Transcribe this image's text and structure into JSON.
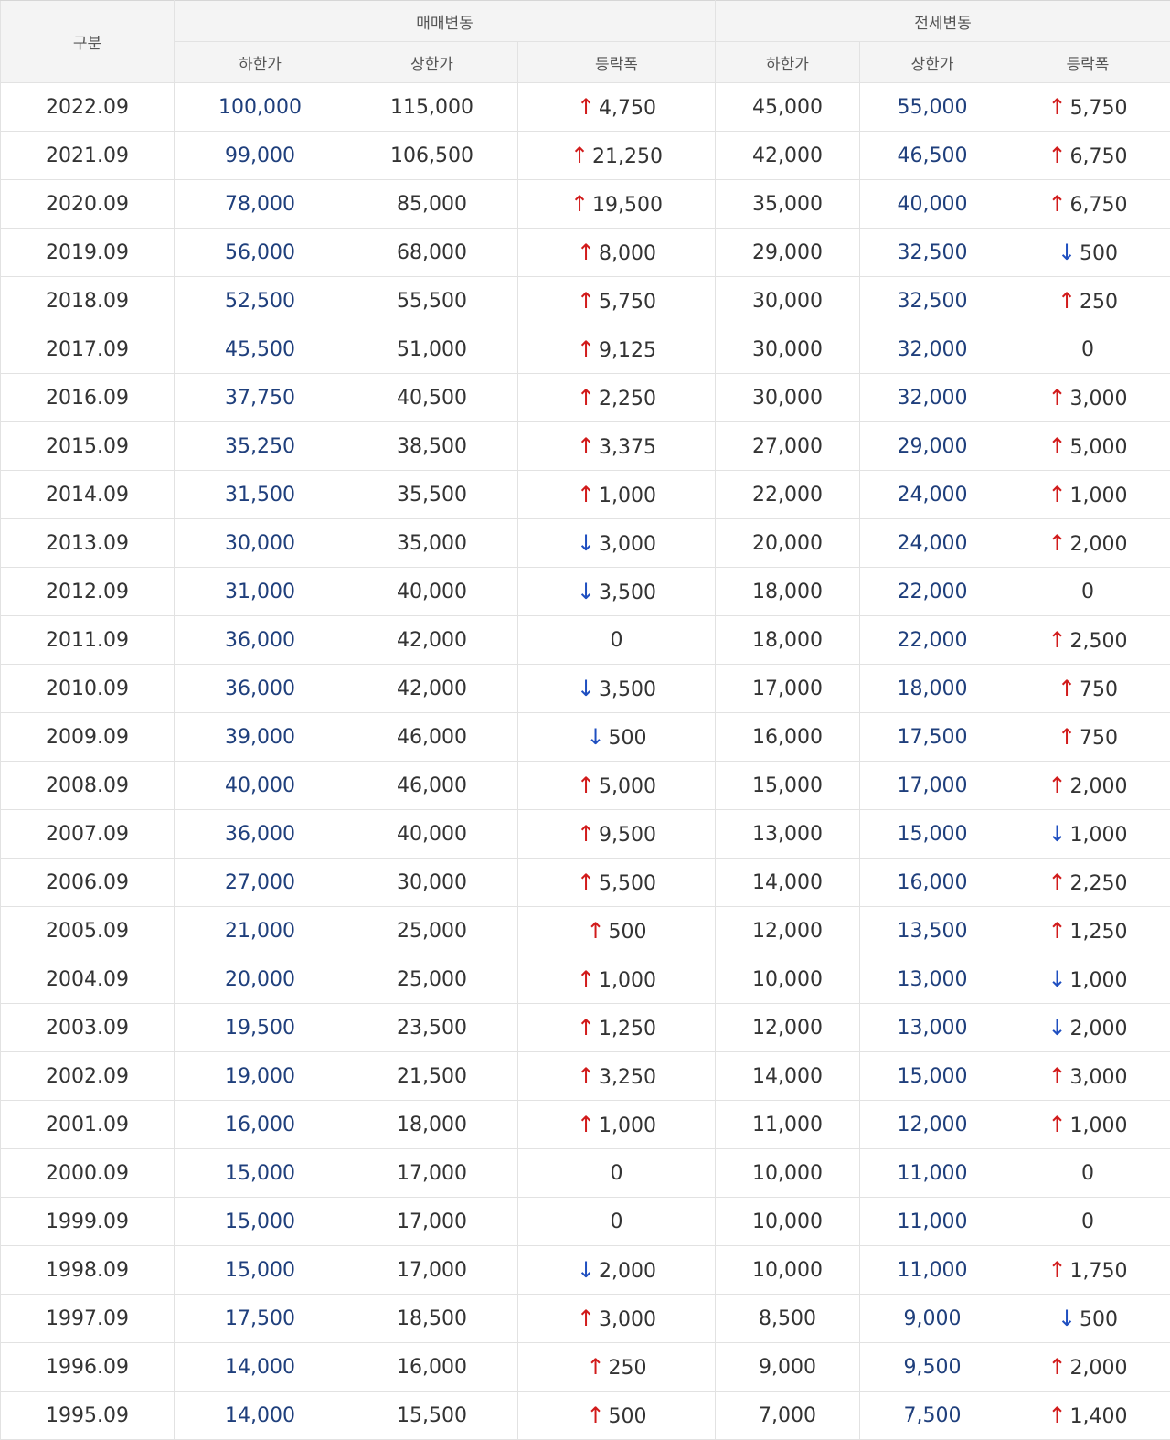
{
  "header": {
    "category_label": "구분",
    "sale_group_label": "매매변동",
    "jeonse_group_label": "전세변동",
    "low_label": "하한가",
    "high_label": "상한가",
    "change_label": "등락폭"
  },
  "rows": [
    {
      "period": "2022.09",
      "sale_low": "100,000",
      "sale_high": "115,000",
      "sale_dir": "up",
      "sale_change": "4,750",
      "jeonse_low": "45,000",
      "jeonse_high": "55,000",
      "jeonse_dir": "up",
      "jeonse_change": "5,750"
    },
    {
      "period": "2021.09",
      "sale_low": "99,000",
      "sale_high": "106,500",
      "sale_dir": "up",
      "sale_change": "21,250",
      "jeonse_low": "42,000",
      "jeonse_high": "46,500",
      "jeonse_dir": "up",
      "jeonse_change": "6,750"
    },
    {
      "period": "2020.09",
      "sale_low": "78,000",
      "sale_high": "85,000",
      "sale_dir": "up",
      "sale_change": "19,500",
      "jeonse_low": "35,000",
      "jeonse_high": "40,000",
      "jeonse_dir": "up",
      "jeonse_change": "6,750"
    },
    {
      "period": "2019.09",
      "sale_low": "56,000",
      "sale_high": "68,000",
      "sale_dir": "up",
      "sale_change": "8,000",
      "jeonse_low": "29,000",
      "jeonse_high": "32,500",
      "jeonse_dir": "down",
      "jeonse_change": "500"
    },
    {
      "period": "2018.09",
      "sale_low": "52,500",
      "sale_high": "55,500",
      "sale_dir": "up",
      "sale_change": "5,750",
      "jeonse_low": "30,000",
      "jeonse_high": "32,500",
      "jeonse_dir": "up",
      "jeonse_change": "250"
    },
    {
      "period": "2017.09",
      "sale_low": "45,500",
      "sale_high": "51,000",
      "sale_dir": "up",
      "sale_change": "9,125",
      "jeonse_low": "30,000",
      "jeonse_high": "32,000",
      "jeonse_dir": "none",
      "jeonse_change": "0"
    },
    {
      "period": "2016.09",
      "sale_low": "37,750",
      "sale_high": "40,500",
      "sale_dir": "up",
      "sale_change": "2,250",
      "jeonse_low": "30,000",
      "jeonse_high": "32,000",
      "jeonse_dir": "up",
      "jeonse_change": "3,000"
    },
    {
      "period": "2015.09",
      "sale_low": "35,250",
      "sale_high": "38,500",
      "sale_dir": "up",
      "sale_change": "3,375",
      "jeonse_low": "27,000",
      "jeonse_high": "29,000",
      "jeonse_dir": "up",
      "jeonse_change": "5,000"
    },
    {
      "period": "2014.09",
      "sale_low": "31,500",
      "sale_high": "35,500",
      "sale_dir": "up",
      "sale_change": "1,000",
      "jeonse_low": "22,000",
      "jeonse_high": "24,000",
      "jeonse_dir": "up",
      "jeonse_change": "1,000"
    },
    {
      "period": "2013.09",
      "sale_low": "30,000",
      "sale_high": "35,000",
      "sale_dir": "down",
      "sale_change": "3,000",
      "jeonse_low": "20,000",
      "jeonse_high": "24,000",
      "jeonse_dir": "up",
      "jeonse_change": "2,000"
    },
    {
      "period": "2012.09",
      "sale_low": "31,000",
      "sale_high": "40,000",
      "sale_dir": "down",
      "sale_change": "3,500",
      "jeonse_low": "18,000",
      "jeonse_high": "22,000",
      "jeonse_dir": "none",
      "jeonse_change": "0"
    },
    {
      "period": "2011.09",
      "sale_low": "36,000",
      "sale_high": "42,000",
      "sale_dir": "none",
      "sale_change": "0",
      "jeonse_low": "18,000",
      "jeonse_high": "22,000",
      "jeonse_dir": "up",
      "jeonse_change": "2,500"
    },
    {
      "period": "2010.09",
      "sale_low": "36,000",
      "sale_high": "42,000",
      "sale_dir": "down",
      "sale_change": "3,500",
      "jeonse_low": "17,000",
      "jeonse_high": "18,000",
      "jeonse_dir": "up",
      "jeonse_change": "750"
    },
    {
      "period": "2009.09",
      "sale_low": "39,000",
      "sale_high": "46,000",
      "sale_dir": "down",
      "sale_change": "500",
      "jeonse_low": "16,000",
      "jeonse_high": "17,500",
      "jeonse_dir": "up",
      "jeonse_change": "750"
    },
    {
      "period": "2008.09",
      "sale_low": "40,000",
      "sale_high": "46,000",
      "sale_dir": "up",
      "sale_change": "5,000",
      "jeonse_low": "15,000",
      "jeonse_high": "17,000",
      "jeonse_dir": "up",
      "jeonse_change": "2,000"
    },
    {
      "period": "2007.09",
      "sale_low": "36,000",
      "sale_high": "40,000",
      "sale_dir": "up",
      "sale_change": "9,500",
      "jeonse_low": "13,000",
      "jeonse_high": "15,000",
      "jeonse_dir": "down",
      "jeonse_change": "1,000"
    },
    {
      "period": "2006.09",
      "sale_low": "27,000",
      "sale_high": "30,000",
      "sale_dir": "up",
      "sale_change": "5,500",
      "jeonse_low": "14,000",
      "jeonse_high": "16,000",
      "jeonse_dir": "up",
      "jeonse_change": "2,250"
    },
    {
      "period": "2005.09",
      "sale_low": "21,000",
      "sale_high": "25,000",
      "sale_dir": "up",
      "sale_change": "500",
      "jeonse_low": "12,000",
      "jeonse_high": "13,500",
      "jeonse_dir": "up",
      "jeonse_change": "1,250"
    },
    {
      "period": "2004.09",
      "sale_low": "20,000",
      "sale_high": "25,000",
      "sale_dir": "up",
      "sale_change": "1,000",
      "jeonse_low": "10,000",
      "jeonse_high": "13,000",
      "jeonse_dir": "down",
      "jeonse_change": "1,000"
    },
    {
      "period": "2003.09",
      "sale_low": "19,500",
      "sale_high": "23,500",
      "sale_dir": "up",
      "sale_change": "1,250",
      "jeonse_low": "12,000",
      "jeonse_high": "13,000",
      "jeonse_dir": "down",
      "jeonse_change": "2,000"
    },
    {
      "period": "2002.09",
      "sale_low": "19,000",
      "sale_high": "21,500",
      "sale_dir": "up",
      "sale_change": "3,250",
      "jeonse_low": "14,000",
      "jeonse_high": "15,000",
      "jeonse_dir": "up",
      "jeonse_change": "3,000"
    },
    {
      "period": "2001.09",
      "sale_low": "16,000",
      "sale_high": "18,000",
      "sale_dir": "up",
      "sale_change": "1,000",
      "jeonse_low": "11,000",
      "jeonse_high": "12,000",
      "jeonse_dir": "up",
      "jeonse_change": "1,000"
    },
    {
      "period": "2000.09",
      "sale_low": "15,000",
      "sale_high": "17,000",
      "sale_dir": "none",
      "sale_change": "0",
      "jeonse_low": "10,000",
      "jeonse_high": "11,000",
      "jeonse_dir": "none",
      "jeonse_change": "0"
    },
    {
      "period": "1999.09",
      "sale_low": "15,000",
      "sale_high": "17,000",
      "sale_dir": "none",
      "sale_change": "0",
      "jeonse_low": "10,000",
      "jeonse_high": "11,000",
      "jeonse_dir": "none",
      "jeonse_change": "0"
    },
    {
      "period": "1998.09",
      "sale_low": "15,000",
      "sale_high": "17,000",
      "sale_dir": "down",
      "sale_change": "2,000",
      "jeonse_low": "10,000",
      "jeonse_high": "11,000",
      "jeonse_dir": "up",
      "jeonse_change": "1,750"
    },
    {
      "period": "1997.09",
      "sale_low": "17,500",
      "sale_high": "18,500",
      "sale_dir": "up",
      "sale_change": "3,000",
      "jeonse_low": "8,500",
      "jeonse_high": "9,000",
      "jeonse_dir": "down",
      "jeonse_change": "500"
    },
    {
      "period": "1996.09",
      "sale_low": "14,000",
      "sale_high": "16,000",
      "sale_dir": "up",
      "sale_change": "250",
      "jeonse_low": "9,000",
      "jeonse_high": "9,500",
      "jeonse_dir": "up",
      "jeonse_change": "2,000"
    },
    {
      "period": "1995.09",
      "sale_low": "14,000",
      "sale_high": "15,500",
      "sale_dir": "up",
      "sale_change": "500",
      "jeonse_low": "7,000",
      "jeonse_high": "7,500",
      "jeonse_dir": "up",
      "jeonse_change": "1,400"
    }
  ],
  "colors": {
    "up": "#d11b1b",
    "down": "#1f4fc0",
    "low_price_text": "#1f3f7c"
  },
  "icons": {
    "up": "arrow-up-icon",
    "down": "arrow-down-icon"
  }
}
